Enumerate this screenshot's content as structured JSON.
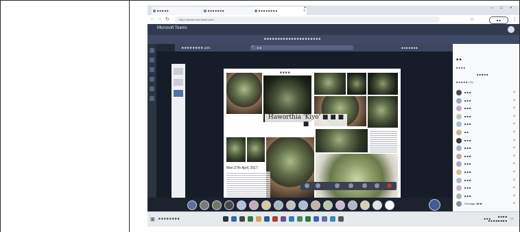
{
  "browser": {
    "tabs": [
      {
        "label": "■ ■ ■ ■ ■"
      },
      {
        "label": "■ ■ ■ ■ ■ ■ ■"
      },
      {
        "label": "■ ■ ■ ■ ■ ■ ■ ■"
      }
    ],
    "url": "https://teams.microsoft.com/...",
    "profile": "■ ■"
  },
  "teams": {
    "brand": "Microsoft Teams",
    "banner": "■ ■ ■ ■ ■ ■ ■ ■ ■ ■ ■ ■ ■ ■ ■ ■ ■ ■ ■ ■ ■",
    "meeting_title": "■ ■ ■ ■ ■ ■ ■ ■ .pptx",
    "search_placeholder": "■ ■",
    "meeting_user": "■ ■ ■ ■ ■ ■ ■"
  },
  "slide": {
    "caption_top": "■ ■ ■ ■",
    "title": "Haworthia 'Kiyo' ■ ■ ■ ■",
    "date": "Mon 27th April, 2017"
  },
  "people": {
    "title": "■ ■",
    "mute_all": "■ ■ ■ ■",
    "all_label": "■ ■ ■ ■ ■",
    "section": "■ ■ ■ ■ ■ (16)",
    "participants": [
      {
        "name": "■ ■ ■",
        "color": "#4a4a4a"
      },
      {
        "name": "■ ■ ■",
        "color": "#9aa7c7"
      },
      {
        "name": "■ ■ ■",
        "color": "#c7a9c2"
      },
      {
        "name": "■ ■ ■",
        "color": "#b8c9a4"
      },
      {
        "name": "■ ■ ■",
        "color": "#9cc1d4"
      },
      {
        "name": "■ ■",
        "color": "#c9b48a"
      },
      {
        "name": "■ ■ ■",
        "color": "#3f3f3f"
      },
      {
        "name": "■ ■ ■",
        "color": "#a0b5c8"
      },
      {
        "name": "■ ■ ■",
        "color": "#c9a6a6"
      },
      {
        "name": "■ ■ ■",
        "color": "#b1a6c9"
      },
      {
        "name": "■ ■ ■",
        "color": "#d3c08f"
      },
      {
        "name": "■ ■ ■",
        "color": "#a8bdc2"
      },
      {
        "name": "■ ■ ■",
        "color": "#c4b2d4"
      },
      {
        "name": "■ ■ ■",
        "color": "#aab8a0"
      },
      {
        "name": "Guangyu (■ ■)",
        "color": "#7f90b0"
      }
    ]
  },
  "taskbar": {
    "search": "■ ■ ■ ■ ■ ■ ■ ■",
    "tray": "■ ■ ■",
    "time": "■ ■:■ ■",
    "date": "■ ■ ■ ■/■ ■/■ ■"
  }
}
